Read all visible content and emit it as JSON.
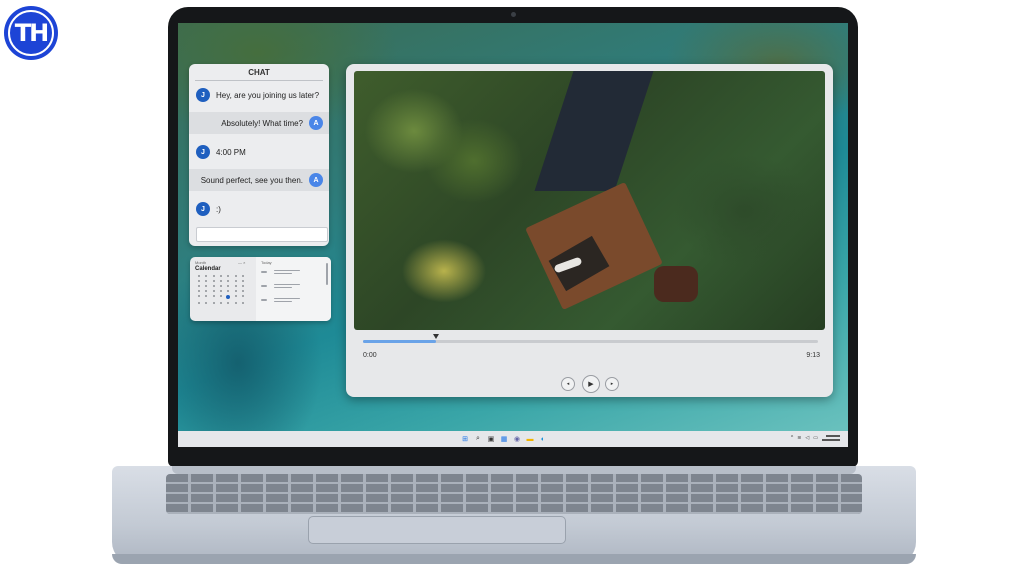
{
  "logo": {
    "text": "TH"
  },
  "chat": {
    "title": "CHAT",
    "messages": [
      {
        "author": "J",
        "text": "Hey, are you joining us later?",
        "side": "left"
      },
      {
        "author": "A",
        "text": "Absolutely! What time?",
        "side": "right"
      },
      {
        "author": "J",
        "text": "4:00 PM",
        "side": "left"
      },
      {
        "author": "A",
        "text": "Sound perfect, see you then.",
        "side": "right"
      },
      {
        "author": "J",
        "text": ":)",
        "side": "left"
      }
    ],
    "input_value": ""
  },
  "calendar": {
    "small_label": "Month",
    "title": "Calendar",
    "window_controls": "— ×",
    "right_label": "Today"
  },
  "player": {
    "current_time": "0:00",
    "total_time": "9:13",
    "progress": 0.16,
    "controls": {
      "prev": "◂",
      "play": "▶",
      "next": "▸"
    }
  },
  "taskbar": {
    "icons": [
      {
        "name": "windows-start-icon",
        "glyph": "⊞",
        "color": "#1a73e8"
      },
      {
        "name": "search-icon",
        "glyph": "⌕",
        "color": "#333333"
      },
      {
        "name": "task-view-icon",
        "glyph": "▣",
        "color": "#333333"
      },
      {
        "name": "widgets-icon",
        "glyph": "▦",
        "color": "#1a73e8"
      },
      {
        "name": "chat-icon",
        "glyph": "◉",
        "color": "#6264a7"
      },
      {
        "name": "file-explorer-icon",
        "glyph": "▬",
        "color": "#f3b500"
      },
      {
        "name": "edge-browser-icon",
        "glyph": "◐",
        "color": "#0c8bd8"
      }
    ],
    "tray": {
      "chevron": "^",
      "wifi": "≋",
      "volume": "◁",
      "battery": "▭"
    }
  },
  "colors": {
    "accent": "#1f5fbf",
    "logo": "#1d44d6"
  }
}
